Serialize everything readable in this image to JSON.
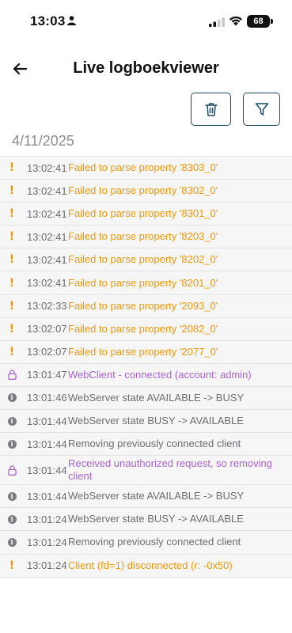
{
  "status_bar": {
    "time": "13:03",
    "battery": "68",
    "icons": [
      "person-icon",
      "signal-icon",
      "wifi-icon",
      "battery-icon"
    ]
  },
  "header": {
    "title": "Live logboekviewer",
    "back_icon": "arrow-left-icon"
  },
  "toolbar": {
    "clear_icon": "trash-icon",
    "filter_icon": "filter-icon"
  },
  "date": "4/11/2025",
  "colors": {
    "warning": "#e89a0c",
    "auth": "#a964cf",
    "info": "#6d6d72",
    "button_border": "#1d4a63"
  },
  "logs": [
    {
      "level": "warning",
      "time": "13:02:41",
      "message": "Failed to parse property '8303_0'"
    },
    {
      "level": "warning",
      "time": "13:02:41",
      "message": "Failed to parse property '8302_0'"
    },
    {
      "level": "warning",
      "time": "13:02:41",
      "message": "Failed to parse property '8301_0'"
    },
    {
      "level": "warning",
      "time": "13:02:41",
      "message": "Failed to parse property '8203_0'"
    },
    {
      "level": "warning",
      "time": "13:02:41",
      "message": "Failed to parse property '8202_0'"
    },
    {
      "level": "warning",
      "time": "13:02:41",
      "message": "Failed to parse property '8201_0'"
    },
    {
      "level": "warning",
      "time": "13:02:33",
      "message": "Failed to parse property '2093_0'"
    },
    {
      "level": "warning",
      "time": "13:02:07",
      "message": "Failed to parse property '2082_0'"
    },
    {
      "level": "warning",
      "time": "13:02:07",
      "message": "Failed to parse property '2077_0'"
    },
    {
      "level": "auth",
      "time": "13:01:47",
      "message": "WebClient - connected (account: admin)"
    },
    {
      "level": "info",
      "time": "13:01:46",
      "message": "WebServer state AVAILABLE -> BUSY"
    },
    {
      "level": "info",
      "time": "13:01:44",
      "message": "WebServer state BUSY -> AVAILABLE"
    },
    {
      "level": "info",
      "time": "13:01:44",
      "message": "Removing previously connected client"
    },
    {
      "level": "auth",
      "time": "13:01:44",
      "message": "Received unauthorized request, so removing client"
    },
    {
      "level": "info",
      "time": "13:01:44",
      "message": "WebServer state AVAILABLE -> BUSY"
    },
    {
      "level": "info",
      "time": "13:01:24",
      "message": "WebServer state BUSY -> AVAILABLE"
    },
    {
      "level": "info",
      "time": "13:01:24",
      "message": "Removing previously connected client"
    },
    {
      "level": "warning",
      "time": "13:01:24",
      "message": "Client (fd=1) disconnected (r: -0x50)"
    }
  ]
}
